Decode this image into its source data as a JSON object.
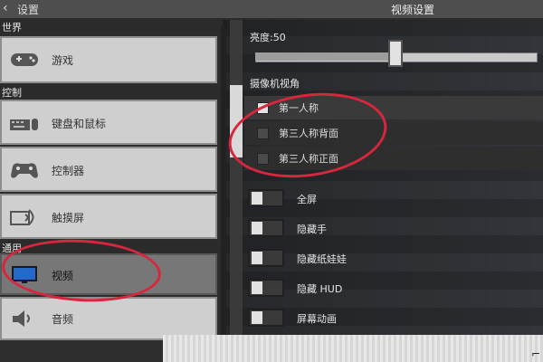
{
  "header": {
    "back_label": "设置",
    "title": "视频设置"
  },
  "sidebar": {
    "sections": [
      {
        "title": "世界"
      },
      {
        "title": "控制"
      },
      {
        "title": "通用"
      }
    ],
    "items": [
      {
        "label": "游戏",
        "icon": "gamepad-icon"
      },
      {
        "label": "键盘和鼠标",
        "icon": "keyboard-mouse-icon"
      },
      {
        "label": "控制器",
        "icon": "controller-icon"
      },
      {
        "label": "触摸屏",
        "icon": "touch-icon"
      },
      {
        "label": "视频",
        "icon": "monitor-icon"
      },
      {
        "label": "音频",
        "icon": "speaker-icon"
      }
    ],
    "selected_index": 4
  },
  "settings": {
    "brightness_label": "亮度:50",
    "brightness_value": 50,
    "camera_label": "摄像机视角",
    "camera_options": [
      {
        "label": "第一人称",
        "selected": true
      },
      {
        "label": "第三人称背面",
        "selected": false
      },
      {
        "label": "第三人称正面",
        "selected": false
      }
    ],
    "toggles": [
      {
        "label": "全屏",
        "on": false
      },
      {
        "label": "隐藏手",
        "on": false
      },
      {
        "label": "隐藏纸娃娃",
        "on": false
      },
      {
        "label": "隐藏 HUD",
        "on": false
      },
      {
        "label": "屏幕动画",
        "on": false
      }
    ]
  },
  "annotations": {
    "color": "#d7263d"
  },
  "watermark": "⌐"
}
